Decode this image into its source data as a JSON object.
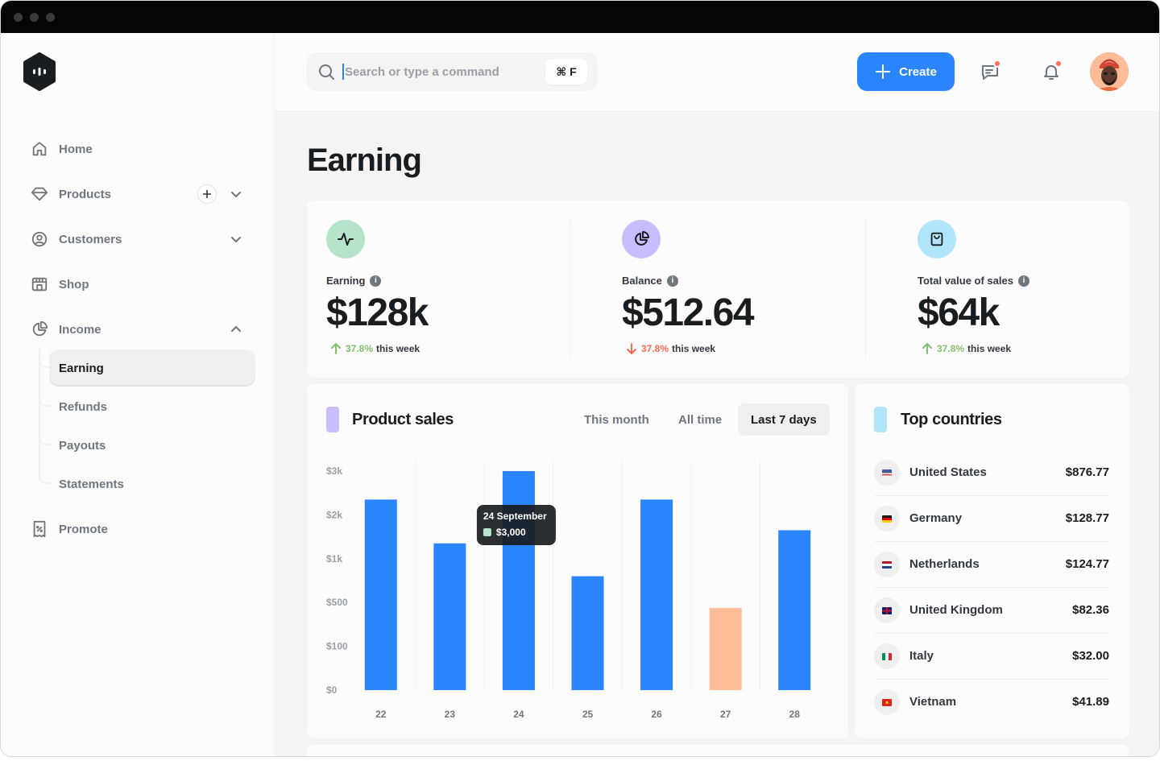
{
  "sidebar": {
    "items": [
      {
        "label": "Home"
      },
      {
        "label": "Products"
      },
      {
        "label": "Customers"
      },
      {
        "label": "Shop"
      },
      {
        "label": "Income"
      },
      {
        "label": "Promote"
      }
    ],
    "income_sub": [
      {
        "label": "Earning",
        "active": true
      },
      {
        "label": "Refunds"
      },
      {
        "label": "Payouts"
      },
      {
        "label": "Statements"
      }
    ]
  },
  "header": {
    "search_placeholder": "Search or type a command",
    "shortcut": "⌘ F",
    "create_label": "Create"
  },
  "colors": {
    "accent": "#2a85ff",
    "highlight_bar": "#ffbc99",
    "notification": "#ff6a55",
    "positive": "#83bf6e",
    "negative": "#ff6a55"
  },
  "page": {
    "title": "Earning"
  },
  "stats": [
    {
      "label": "Earning",
      "value": "$128k",
      "change": "37.8%",
      "change_suffix": "this week",
      "direction": "up",
      "icon": "activity-icon",
      "color": "#b5e4ca"
    },
    {
      "label": "Balance",
      "value": "$512.64",
      "change": "37.8%",
      "change_suffix": "this week",
      "direction": "down",
      "icon": "pie-chart-icon",
      "color": "#cabdff"
    },
    {
      "label": "Total value of sales",
      "value": "$64k",
      "change": "37.8%",
      "change_suffix": "this week",
      "direction": "up",
      "icon": "shopping-bag-icon",
      "color": "#b1e5fc"
    }
  ],
  "product_sales": {
    "title": "Product sales",
    "tabs": [
      "This month",
      "All time",
      "Last 7 days"
    ],
    "active_tab": "Last 7 days",
    "tooltip": {
      "date": "24 September",
      "value": "$3,000"
    }
  },
  "chart_data": {
    "type": "bar",
    "title": "Product sales",
    "xlabel": "",
    "ylabel": "",
    "categories": [
      "22",
      "23",
      "24",
      "25",
      "26",
      "27",
      "28"
    ],
    "y_ticks": [
      "$0",
      "$100",
      "$500",
      "$1k",
      "$2k",
      "$3k"
    ],
    "y_tick_values": [
      0,
      100,
      500,
      1000,
      2000,
      3000
    ],
    "scale": "non-linear (evenly spaced ticks)",
    "values": [
      2350,
      1350,
      3000,
      800,
      2350,
      450,
      1650
    ],
    "highlight_index": 5,
    "grid": "vertical",
    "legend": "none"
  },
  "top_countries": {
    "title": "Top countries",
    "rows": [
      {
        "name": "United States",
        "value": "$876.77",
        "flag": "us-flag-icon",
        "flag_color": "#3b5ba5"
      },
      {
        "name": "Germany",
        "value": "$128.77",
        "flag": "germany-flag-icon",
        "flag_color": "#dd0000"
      },
      {
        "name": "Netherlands",
        "value": "$124.77",
        "flag": "netherlands-flag-icon",
        "flag_color": "#ae1c28"
      },
      {
        "name": "United Kingdom",
        "value": "$82.36",
        "flag": "uk-flag-icon",
        "flag_color": "#012169"
      },
      {
        "name": "Italy",
        "value": "$32.00",
        "flag": "italy-flag-icon",
        "flag_color": "#009246"
      },
      {
        "name": "Vietnam",
        "value": "$41.89",
        "flag": "vietnam-flag-icon",
        "flag_color": "#da251d"
      }
    ]
  }
}
